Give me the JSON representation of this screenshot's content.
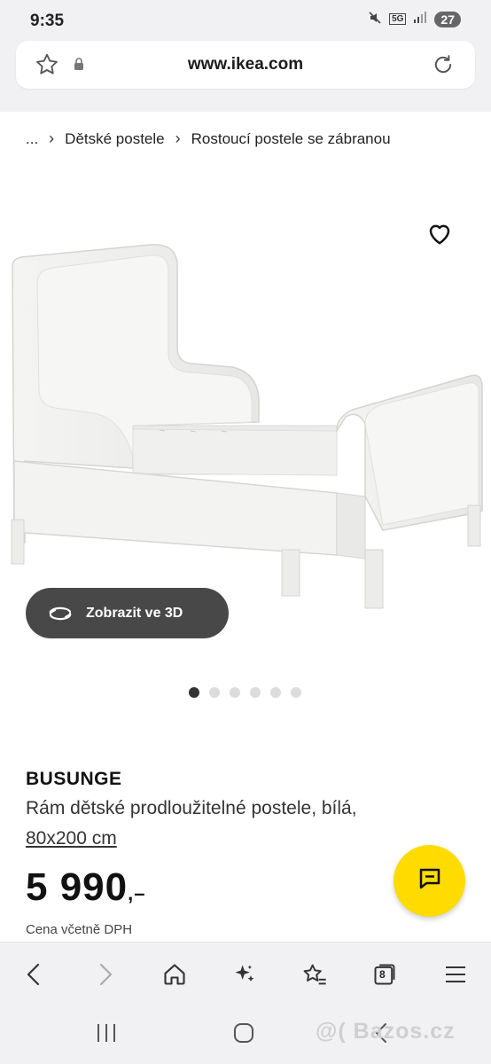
{
  "status": {
    "time": "9:35",
    "network": "5G",
    "battery": "27"
  },
  "browser": {
    "url": "www.ikea.com"
  },
  "breadcrumb": {
    "root": "...",
    "item1": "Dětské postele",
    "item2": "Rostoucí postele se zábranou"
  },
  "gallery": {
    "view3d_label": "Zobrazit ve 3D",
    "dot_count": 6,
    "active_dot": 1
  },
  "product": {
    "name": "BUSUNGE",
    "description": "Rám dětské prodloužitelné postele, bílá,",
    "size": "80x200 cm",
    "price": "5 990",
    "price_suffix": ",–",
    "price_note": "Cena včetně DPH"
  },
  "bottom_nav": {
    "tabs_count": "8"
  },
  "watermark": "@( Bazos.cz",
  "colors": {
    "chat_button": "#ffdb00",
    "view3d_button": "#484848",
    "bar_background": "#f1f1f4"
  }
}
